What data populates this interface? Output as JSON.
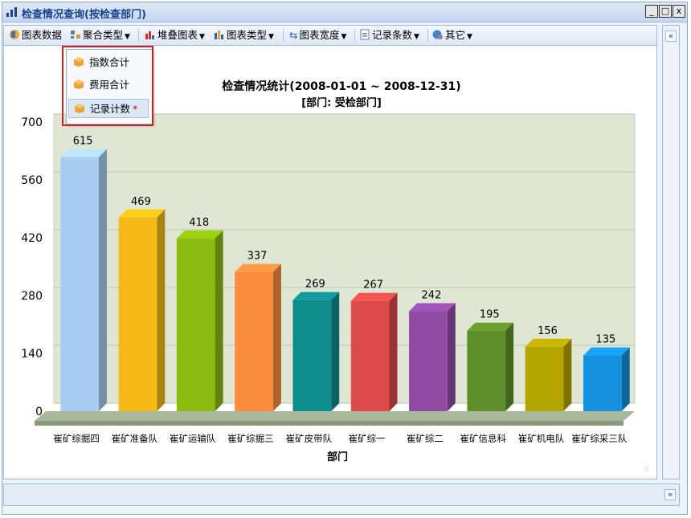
{
  "window": {
    "title": "检查情况查询(按检查部门)",
    "controls": {
      "minimize": "_",
      "restore": "□",
      "close": "x"
    }
  },
  "toolbar": {
    "chart_data_label": "图表数据",
    "aggregate_type_label": "聚合类型",
    "stacked_chart_label": "堆叠图表",
    "chart_type_label": "图表类型",
    "chart_width_label": "图表宽度",
    "record_count_label": "记录条数",
    "other_label": "其它"
  },
  "dropdown": {
    "items": [
      {
        "label": "指数合计",
        "selected": false
      },
      {
        "label": "费用合计",
        "selected": false
      },
      {
        "label": "记录计数",
        "selected": true,
        "marker": "*"
      }
    ]
  },
  "side": {
    "collapse_right": "«",
    "collapse_bottom": "»"
  },
  "colors": {
    "highlight_border": "#cc1f1f",
    "plot_background": "#dfe6d4",
    "floor": "#a8b89a"
  },
  "chart_data": {
    "type": "bar",
    "title": "检查情况统计(2008-01-01 ~ 2008-12-31)",
    "subtitle": "[部门: 受检部门]",
    "xlabel": "部门",
    "ylabel": "",
    "ylim": [
      0,
      700
    ],
    "yticks": [
      0,
      140,
      280,
      420,
      560,
      700
    ],
    "grid": true,
    "categories": [
      "崔矿综掘四",
      "崔矿准备队",
      "崔矿运输队",
      "崔矿综掘三",
      "崔矿皮带队",
      "崔矿综一",
      "崔矿综二",
      "崔矿信息科",
      "崔矿机电队",
      "崔矿综采三队"
    ],
    "values": [
      615,
      469,
      418,
      337,
      269,
      267,
      242,
      195,
      156,
      135
    ],
    "colors": [
      "#a9cdf2",
      "#f6b917",
      "#8cbb12",
      "#fb8c3f",
      "#0f8c8c",
      "#dc4a4a",
      "#914ba5",
      "#5f8f2a",
      "#b5a500",
      "#1492df"
    ]
  }
}
